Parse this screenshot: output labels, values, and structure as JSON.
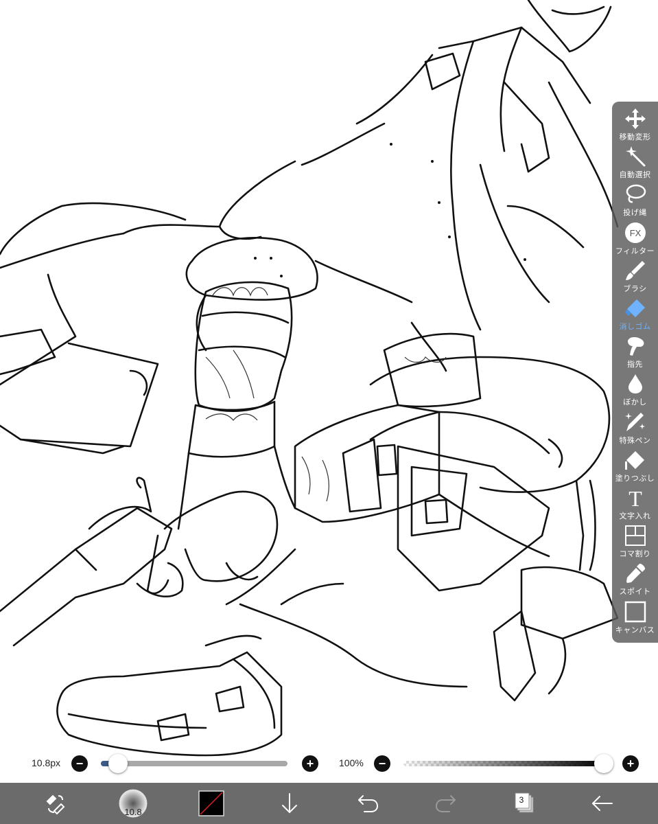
{
  "tools": [
    {
      "id": "move",
      "label": "移動変形",
      "icon": "move-arrows-icon"
    },
    {
      "id": "magic",
      "label": "自動選択",
      "icon": "magic-wand-icon"
    },
    {
      "id": "lasso",
      "label": "投げ縄",
      "icon": "lasso-icon"
    },
    {
      "id": "filter",
      "label": "フィルター",
      "icon": "fx-icon",
      "icon_text": "FX"
    },
    {
      "id": "brush",
      "label": "ブラシ",
      "icon": "brush-icon"
    },
    {
      "id": "eraser",
      "label": "消しゴム",
      "icon": "eraser-icon",
      "active": true
    },
    {
      "id": "finger",
      "label": "指先",
      "icon": "finger-smudge-icon"
    },
    {
      "id": "blur",
      "label": "ぼかし",
      "icon": "blur-drop-icon"
    },
    {
      "id": "special",
      "label": "特殊ペン",
      "icon": "special-pen-icon"
    },
    {
      "id": "fill",
      "label": "塗りつぶし",
      "icon": "fill-bucket-icon"
    },
    {
      "id": "text",
      "label": "文字入れ",
      "icon": "text-icon",
      "icon_text": "T"
    },
    {
      "id": "frame",
      "label": "コマ割り",
      "icon": "frame-divider-icon"
    },
    {
      "id": "dropper",
      "label": "スポイト",
      "icon": "eyedropper-icon"
    },
    {
      "id": "canvas",
      "label": "キャンバス",
      "icon": "canvas-icon"
    }
  ],
  "sliders": {
    "size": {
      "label": "10.8px",
      "fraction": 0.04
    },
    "opacity": {
      "label": "100%",
      "fraction": 1.0
    }
  },
  "bottombar": {
    "brush_size": "10.8",
    "layer_count": "3",
    "icons": [
      "tool-switch-icon",
      "brush-size-icon",
      "color-swatch-icon",
      "download-arrow-icon",
      "undo-icon",
      "redo-icon",
      "layers-icon",
      "back-arrow-icon"
    ]
  },
  "colors": {
    "panel_bg": "#5a5a5a",
    "active_tool": "#6fb3ff",
    "size_slider_fill": "#3b5a8a",
    "bottombar_bg": "#6b6b6b",
    "current_color": "#000000"
  }
}
